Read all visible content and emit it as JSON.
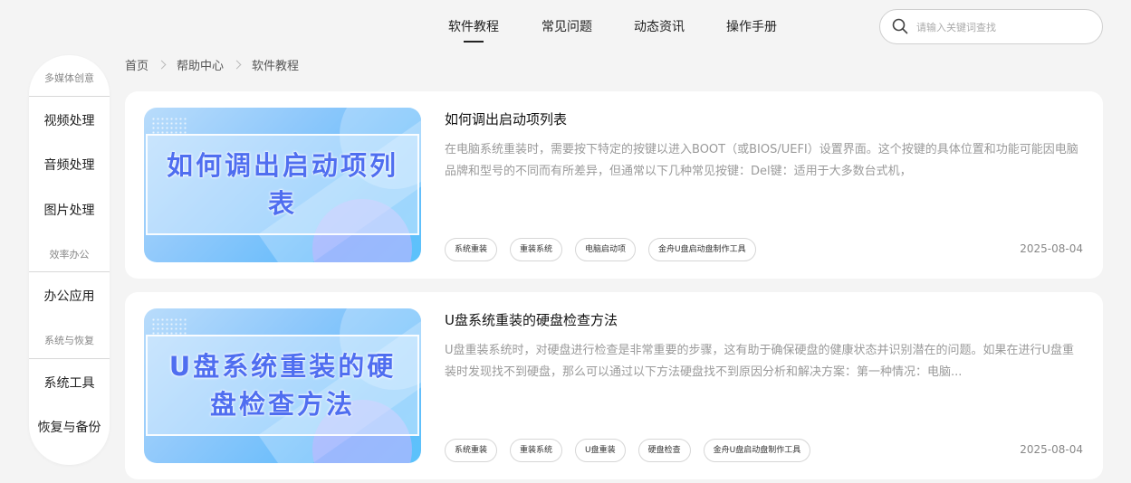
{
  "nav": {
    "items": [
      {
        "label": "软件教程",
        "active": true
      },
      {
        "label": "常见问题",
        "active": false
      },
      {
        "label": "动态资讯",
        "active": false
      },
      {
        "label": "操作手册",
        "active": false
      }
    ]
  },
  "search": {
    "placeholder": "请输入关键词查找",
    "value": ""
  },
  "sidebar": {
    "groups": [
      {
        "title": "多媒体创意",
        "items": [
          "视频处理",
          "音频处理",
          "图片处理"
        ]
      },
      {
        "title": "效率办公",
        "items": [
          "办公应用"
        ]
      },
      {
        "title": "系统与恢复",
        "items": [
          "系统工具",
          "恢复与备份"
        ]
      }
    ]
  },
  "breadcrumb": [
    "首页",
    "帮助中心",
    "软件教程"
  ],
  "articles": [
    {
      "thumb_text": "如何调出启动项列表",
      "title": "如何调出启动项列表",
      "desc": "在电脑系统重装时，需要按下特定的按键以进入BOOT（或BIOS/UEFI）设置界面。这个按键的具体位置和功能可能因电脑品牌和型号的不同而有所差异，但通常以下几种常见按键：Del键：适用于大多数台式机，",
      "tags": [
        "系统重装",
        "重装系统",
        "电脑启动项",
        "金舟U盘启动盘制作工具"
      ],
      "date": "2025-08-04"
    },
    {
      "thumb_text": "U盘系统重装的硬盘检查方法",
      "title": "U盘系统重装的硬盘检查方法",
      "desc": "U盘重装系统时，对硬盘进行检查是非常重要的步骤，这有助于确保硬盘的健康状态并识别潜在的问题。如果在进行U盘重装时发现找不到硬盘，那么可以通过以下方法硬盘找不到原因分析和解决方案：第一种情况：电脑...",
      "tags": [
        "系统重装",
        "重装系统",
        "U盘重装",
        "硬盘检查",
        "金舟U盘启动盘制作工具"
      ],
      "date": "2025-08-04"
    }
  ],
  "colors": {
    "accent": "#4f6ef0",
    "background": "#f4f4f4"
  }
}
